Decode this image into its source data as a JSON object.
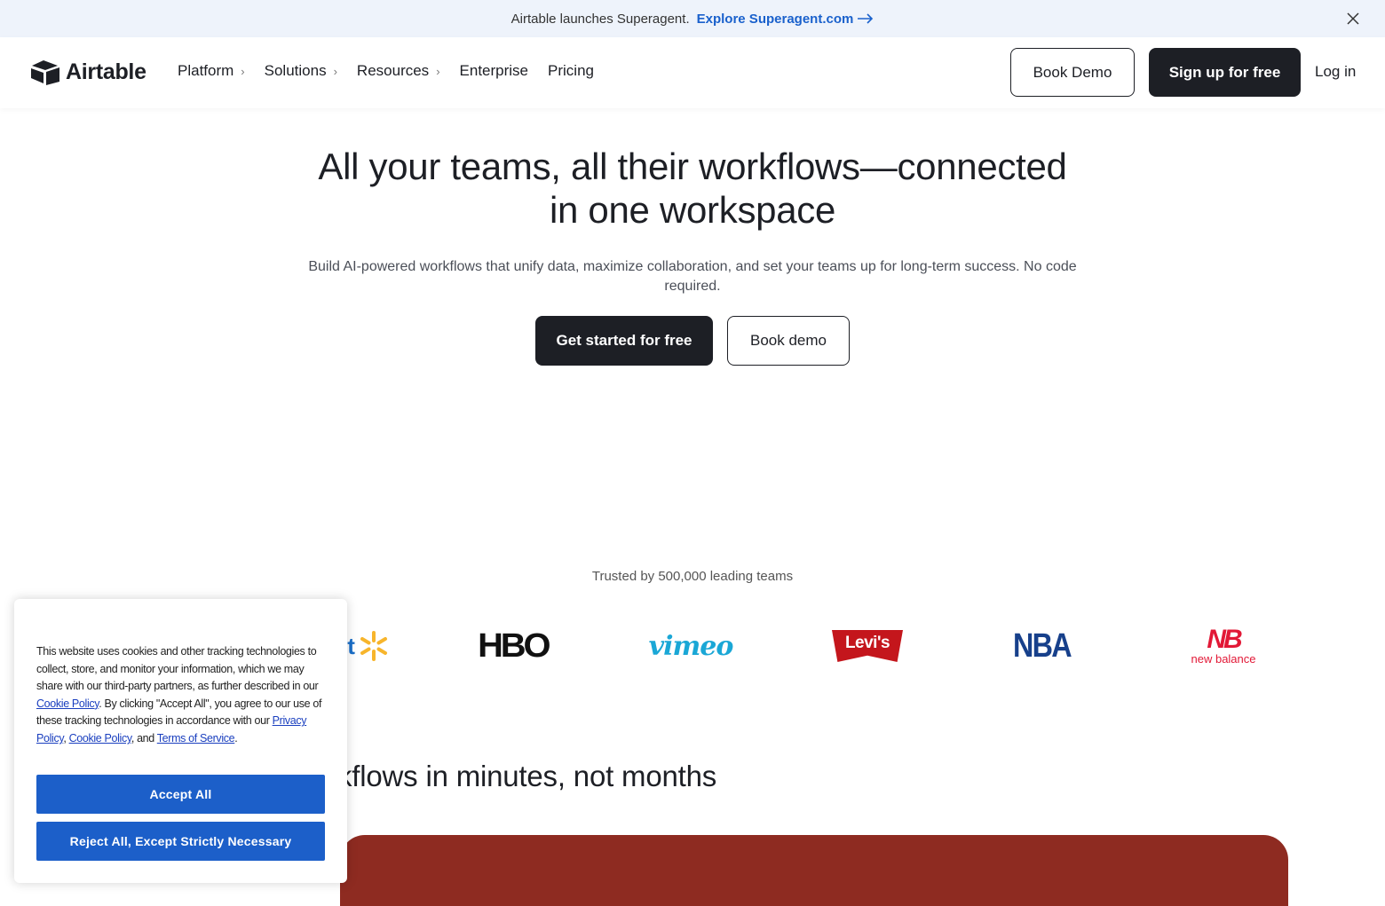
{
  "announcement": {
    "message": "Airtable launches Superagent.",
    "link_label": "Explore Superagent.com"
  },
  "nav": {
    "logo_text": "Airtable",
    "menu": [
      {
        "label": "Platform",
        "has_submenu": true
      },
      {
        "label": "Solutions",
        "has_submenu": true
      },
      {
        "label": "Resources",
        "has_submenu": true
      },
      {
        "label": "Enterprise",
        "has_submenu": false
      },
      {
        "label": "Pricing",
        "has_submenu": false
      }
    ],
    "book_demo_label": "Book Demo",
    "signup_label": "Sign up for free",
    "login_label": "Log in"
  },
  "hero": {
    "title_line1": "All your teams, all their workflows—connected",
    "title_line2": "in one workspace",
    "subtitle": "Build AI-powered workflows that unify data, maximize collaboration, and set your teams up for long-term success. No code required.",
    "cta_primary": "Get started for free",
    "cta_secondary": "Book demo"
  },
  "trusted": {
    "label": "Trusted by 500,000 leading teams",
    "logos": [
      "walmart-logo",
      "hbo-logo",
      "vimeo-logo",
      "levis-logo",
      "nba-logo",
      "new-balance-logo"
    ],
    "walmart_partial": "rt",
    "hbo": "HBO",
    "vimeo": "vimeo",
    "levis": "Levi's",
    "nba": "NBA",
    "new_balance": "new balance"
  },
  "section": {
    "title_partial": "kflows in minutes, not months"
  },
  "cookie_banner": {
    "text_1": "This website uses cookies and other tracking technologies to collect, store, and monitor your information, which we may share with our third-party partners, as further described in our ",
    "link_cookie_policy": "Cookie Policy",
    "text_2": ". By clicking \"Accept All\", you agree to our use of these tracking technologies in accordance with our ",
    "link_privacy_policy": "Privacy Policy",
    "text_3": ", ",
    "link_cookie_policy_2": "Cookie Policy",
    "text_4": ", and ",
    "link_terms": "Terms of Service",
    "text_5": ".",
    "accept_label": "Accept All",
    "reject_label": "Reject All, Except Strictly Necessary"
  },
  "colors": {
    "announcement_bg": "#eef3fb",
    "link_blue": "#1a61cc",
    "dark_button": "#1d1f25",
    "cookie_button": "#1c5fc9",
    "card_red": "#8e2b21"
  }
}
